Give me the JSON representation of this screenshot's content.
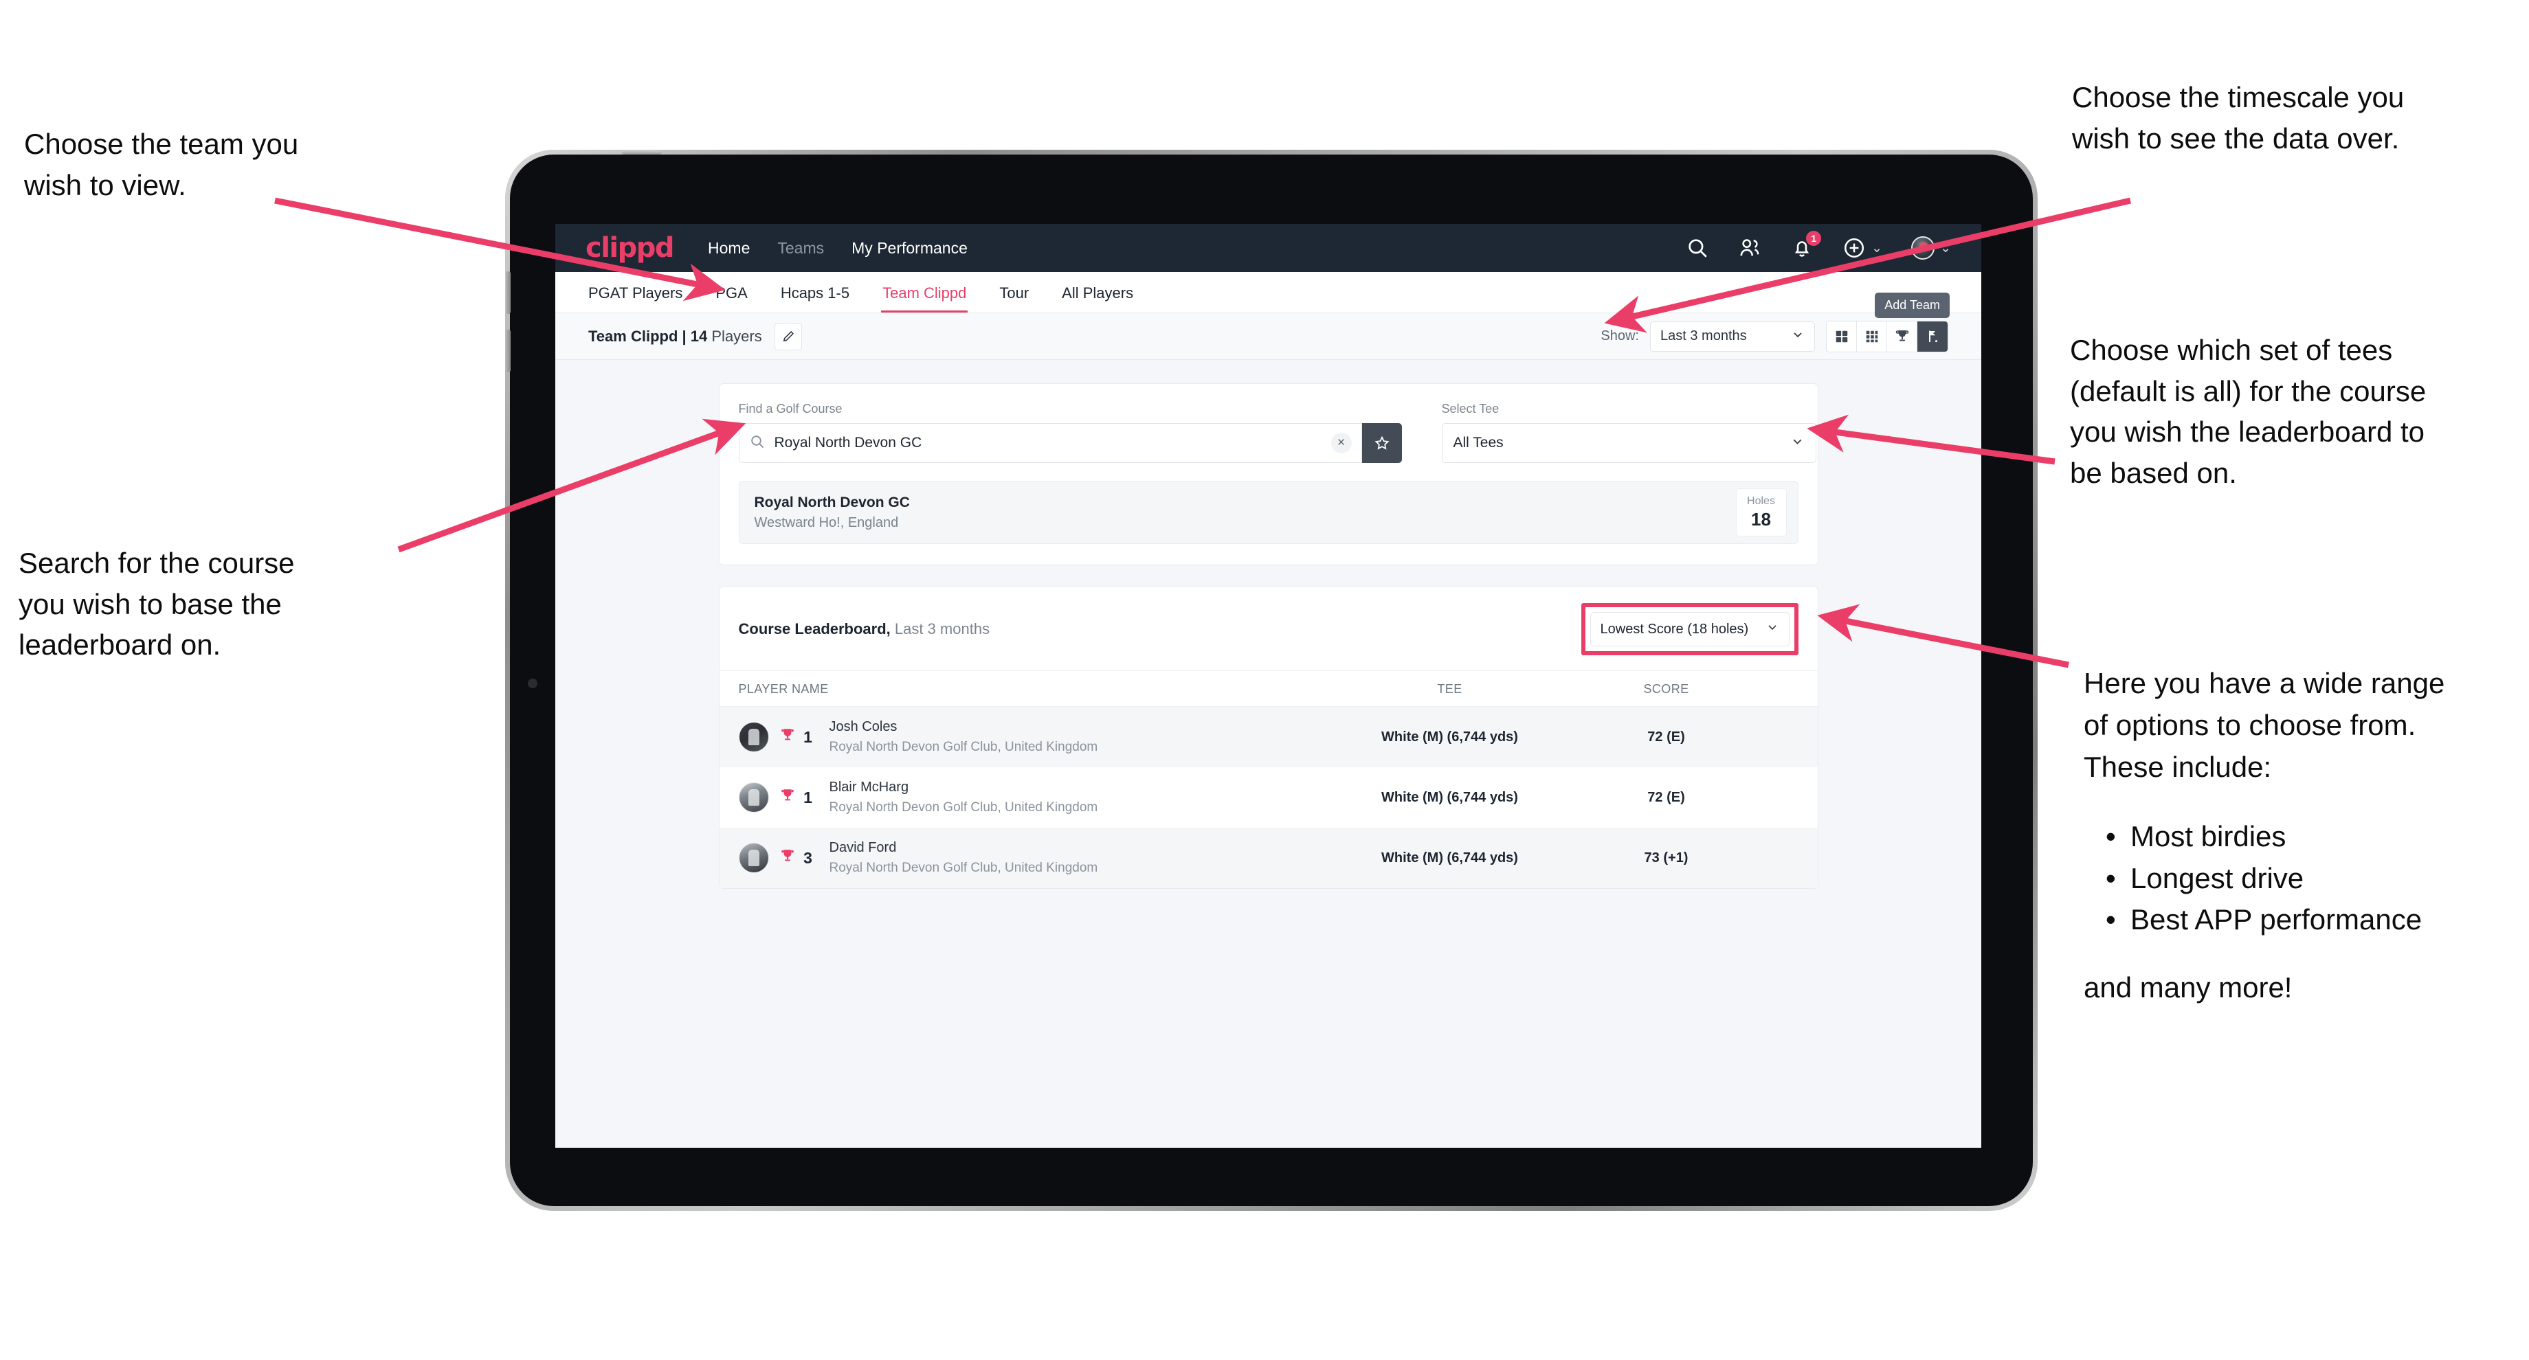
{
  "brand": {
    "accent": "#ea3e69",
    "navbar_bg": "#1d2834",
    "logo": "clippd"
  },
  "navbar": {
    "links": [
      {
        "label": "Home",
        "dim": false
      },
      {
        "label": "Teams",
        "dim": true
      },
      {
        "label": "My Performance",
        "dim": false
      }
    ],
    "icons": [
      {
        "name": "search-icon"
      },
      {
        "name": "people-icon"
      },
      {
        "name": "bell-icon",
        "badge": "1"
      },
      {
        "name": "plus-circle-icon",
        "caret": "⌄"
      },
      {
        "name": "avatar",
        "caret": "⌄"
      }
    ],
    "notification_count": "1"
  },
  "tabs": {
    "items": [
      {
        "label": "PGAT Players",
        "state": "normal"
      },
      {
        "label": "PGA",
        "state": "normal"
      },
      {
        "label": "Hcaps 1-5",
        "state": "normal"
      },
      {
        "label": "Team Clippd",
        "state": "active"
      },
      {
        "label": "Tour",
        "state": "normal"
      },
      {
        "label": "All Players",
        "state": "normal"
      }
    ],
    "tooltip": "Add Team"
  },
  "toolbar": {
    "team_name": "Team Clippd",
    "separator": " | ",
    "player_count": "14",
    "players_word": " Players",
    "edit_icon": "pencil-icon",
    "show_label": "Show:",
    "show_value": "Last 3 months",
    "show_caret": "⌄",
    "view_buttons": [
      {
        "name": "grid-2x2-view-button",
        "active": false
      },
      {
        "name": "grid-3x3-view-button",
        "active": false
      },
      {
        "name": "trophy-view-button",
        "active": false
      },
      {
        "name": "flag-view-button",
        "active": true
      }
    ]
  },
  "search_card": {
    "course_label": "Find a Golf Course",
    "course_value": "Royal North Devon GC",
    "course_placeholder": "Find a Golf Course",
    "clear_glyph": "×",
    "favourite_icon": "star-icon",
    "tee_label": "Select Tee",
    "tee_value": "All Tees",
    "tee_caret": "⌄",
    "result": {
      "name": "Royal North Devon GC",
      "location": "Westward Ho!, England",
      "holes_label": "Holes",
      "holes_value": "18"
    }
  },
  "leaderboard": {
    "title": "Course Leaderboard,",
    "subtitle": " Last 3 months",
    "metric_value": "Lowest Score (18 holes)",
    "metric_caret": "⌄",
    "columns": [
      "PLAYER NAME",
      "TEE",
      "SCORE"
    ],
    "rows": [
      {
        "rank": "1",
        "name": "Josh Coles",
        "club": "Royal North Devon Golf Club, United Kingdom",
        "tee": "White (M) (6,744 yds)",
        "score": "72 (E)",
        "avatar": "av1"
      },
      {
        "rank": "1",
        "name": "Blair McHarg",
        "club": "Royal North Devon Golf Club, United Kingdom",
        "tee": "White (M) (6,744 yds)",
        "score": "72 (E)",
        "avatar": "av2"
      },
      {
        "rank": "3",
        "name": "David Ford",
        "club": "Royal North Devon Golf Club, United Kingdom",
        "tee": "White (M) (6,744 yds)",
        "score": "73 (+1)",
        "avatar": "av3"
      }
    ]
  },
  "annotations": {
    "team": "Choose the team you\nwish to view.",
    "search": "Search for the course\nyou wish to base the\nleaderboard on.",
    "timescale": "Choose the timescale you\nwish to see the data over.",
    "tees": "Choose which set of tees\n(default is all) for the course\nyou wish the leaderboard to\nbe based on.",
    "options_intro": "Here you have a wide range\nof options to choose from.\nThese include:",
    "options_list": [
      "Most birdies",
      "Longest drive",
      "Best APP performance"
    ],
    "options_outro": "and many more!"
  }
}
